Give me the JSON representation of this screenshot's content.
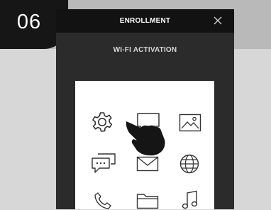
{
  "step": {
    "number": "06"
  },
  "screen": {
    "title": "ENROLLMENT",
    "subtitle": "WI-FI ACTIVATION",
    "close_icon": "close-icon"
  },
  "app_grid": {
    "icons": [
      "gear-icon",
      "chat-icon",
      "image-icon",
      "messages-icon",
      "mail-icon",
      "globe-icon",
      "phone-icon",
      "folder-icon",
      "music-icon"
    ]
  },
  "colors": {
    "page_background": "#d7d7d7",
    "top_band": "#b9b9b9",
    "step_tab": "#161616",
    "header": "#121212",
    "phone_body": "#2b2b2b",
    "panel": "#ffffff"
  }
}
